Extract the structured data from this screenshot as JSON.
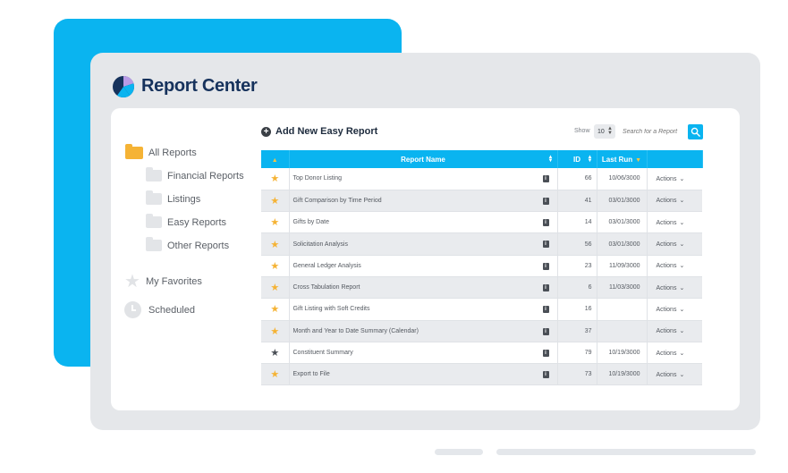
{
  "app": {
    "title": "Report Center"
  },
  "sidebar": {
    "items": [
      {
        "label": "All Reports"
      },
      {
        "label": "Financial Reports"
      },
      {
        "label": "Listings"
      },
      {
        "label": "Easy Reports"
      },
      {
        "label": "Other Reports"
      },
      {
        "label": "My Favorites"
      },
      {
        "label": "Scheduled"
      }
    ]
  },
  "toolbar": {
    "add_label": "Add New Easy Report",
    "show_label": "Show",
    "show_value": "10",
    "search_placeholder": "Search for a Report"
  },
  "table": {
    "columns": [
      "Report Name",
      "ID",
      "Last Run"
    ],
    "rows": [
      {
        "name": "Top Donor Listing",
        "id": "66",
        "last_run": "10/06/3000",
        "action": "Actions",
        "favorite": "gold"
      },
      {
        "name": "Gift Comparison by Time Period",
        "id": "41",
        "last_run": "03/01/3000",
        "action": "Actions",
        "favorite": "gold"
      },
      {
        "name": "Gifts by Date",
        "id": "14",
        "last_run": "03/01/3000",
        "action": "Actions",
        "favorite": "gold"
      },
      {
        "name": "Solicitation Analysis",
        "id": "56",
        "last_run": "03/01/3000",
        "action": "Actions",
        "favorite": "gold"
      },
      {
        "name": "General Ledger Analysis",
        "id": "23",
        "last_run": "11/09/3000",
        "action": "Actions",
        "favorite": "gold"
      },
      {
        "name": "Cross Tabulation Report",
        "id": "6",
        "last_run": "11/03/3000",
        "action": "Actions",
        "favorite": "gold"
      },
      {
        "name": "Gift Listing with Soft Credits",
        "id": "16",
        "last_run": "",
        "action": "Actions",
        "favorite": "gold"
      },
      {
        "name": "Month and Year to Date Summary (Calendar)",
        "id": "37",
        "last_run": "",
        "action": "Actions",
        "favorite": "gold"
      },
      {
        "name": "Constituent Summary",
        "id": "79",
        "last_run": "10/19/3000",
        "action": "Actions",
        "favorite": "dark"
      },
      {
        "name": "Export to File",
        "id": "73",
        "last_run": "10/19/3000",
        "action": "Actions",
        "favorite": "gold"
      }
    ]
  },
  "colors": {
    "accent": "#0ab4f0",
    "brand_text": "#16325c",
    "star_gold": "#f5b335",
    "panel_gray": "#e5e7ea"
  },
  "icons": {
    "brand": "pie-chart-icon",
    "folder_open": "folder-open-icon",
    "folder": "folder-icon",
    "favorites": "star-icon",
    "scheduled": "clock-icon",
    "add": "plus-circle-icon",
    "search": "search-icon",
    "info": "info-icon"
  }
}
